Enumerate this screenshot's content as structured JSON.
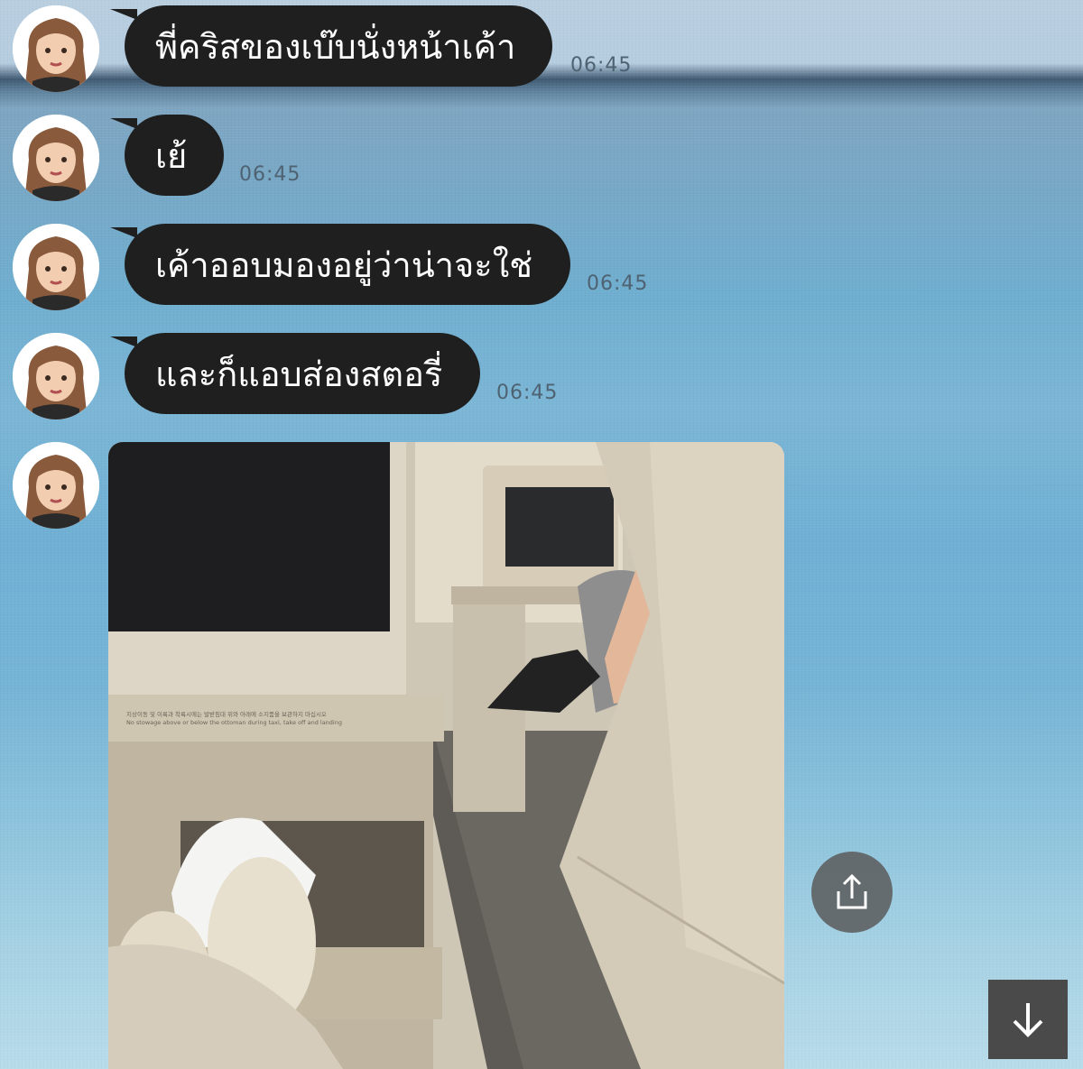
{
  "chat": {
    "messages": [
      {
        "text": "พี่คริสของเบ๊บนั่งหน้าเค้า",
        "time": "06:45"
      },
      {
        "text": "เย้",
        "time": "06:45"
      },
      {
        "text": "เค้าออบมองอยู่ว่าน่าจะใช่",
        "time": "06:45"
      },
      {
        "text": "และก็แอบส่องสตอรี่",
        "time": "06:45"
      }
    ],
    "photo": {
      "caption_line1": "지상이동 및 이륙과 착륙시에는 발받침대 위와 아래에 소지품을 보관하지 마십시오",
      "caption_line2": "No stowage above or below the ottoman during taxi, take off and landing"
    }
  },
  "icons": {
    "avatar": "memoji-avatar-icon",
    "share": "share-icon",
    "scroll_down": "arrow-down-icon"
  },
  "colors": {
    "bubble": "#1f1f1f",
    "bubble_text": "#ffffff",
    "time_text": "#4e6272"
  }
}
